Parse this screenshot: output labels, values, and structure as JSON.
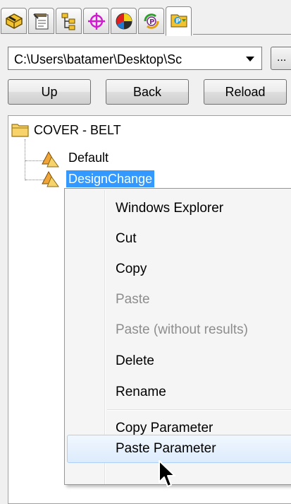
{
  "toolbar": {
    "tabs": [
      {
        "icon": "parts-icon"
      },
      {
        "icon": "properties-icon"
      },
      {
        "icon": "tree-icon"
      },
      {
        "icon": "target-icon"
      },
      {
        "icon": "appearance-icon"
      },
      {
        "icon": "refresh-p-icon"
      },
      {
        "icon": "parameter-library-icon",
        "active": true
      }
    ]
  },
  "path_bar": {
    "value": "C:\\Users\\batamer\\Desktop\\Sc",
    "browse_label": "..."
  },
  "nav": {
    "up_label": "Up",
    "back_label": "Back",
    "reload_label": "Reload"
  },
  "tree": {
    "root_label": "COVER - BELT",
    "items": [
      {
        "label": "Default",
        "selected": false
      },
      {
        "label": "DesignChange",
        "selected": true
      }
    ]
  },
  "context_menu": {
    "items": [
      {
        "label": "Windows Explorer",
        "enabled": true
      },
      {
        "label": "Cut",
        "enabled": true
      },
      {
        "label": "Copy",
        "enabled": true
      },
      {
        "label": "Paste",
        "enabled": false
      },
      {
        "label": "Paste (without results)",
        "enabled": false
      },
      {
        "label": "Delete",
        "enabled": true
      },
      {
        "label": "Rename",
        "enabled": true
      },
      {
        "label": "Copy Parameter",
        "enabled": true
      },
      {
        "label": "Paste Parameter",
        "enabled": true,
        "hovered": true
      }
    ]
  },
  "colors": {
    "selection": "#3399ff",
    "disabled_text": "#8d8d8d",
    "hover_border": "#aecff7"
  }
}
